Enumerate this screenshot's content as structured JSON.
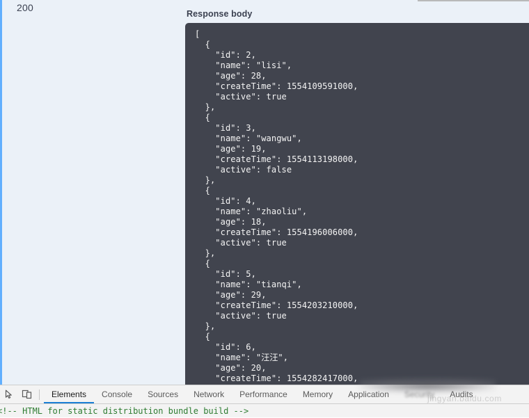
{
  "swagger": {
    "status_code": "200",
    "response_body_label": "Response body",
    "response_body_json": "[\n  {\n    \"id\": 2,\n    \"name\": \"lisi\",\n    \"age\": 28,\n    \"createTime\": 1554109591000,\n    \"active\": true\n  },\n  {\n    \"id\": 3,\n    \"name\": \"wangwu\",\n    \"age\": 19,\n    \"createTime\": 1554113198000,\n    \"active\": false\n  },\n  {\n    \"id\": 4,\n    \"name\": \"zhaoliu\",\n    \"age\": 18,\n    \"createTime\": 1554196006000,\n    \"active\": true\n  },\n  {\n    \"id\": 5,\n    \"name\": \"tianqi\",\n    \"age\": 29,\n    \"createTime\": 1554203210000,\n    \"active\": true\n  },\n  {\n    \"id\": 6,\n    \"name\": \"汪汪\",\n    \"age\": 20,\n    \"createTime\": 1554282417000,",
    "records": [
      {
        "id": 2,
        "name": "lisi",
        "age": 28,
        "createTime": 1554109591000,
        "active": true
      },
      {
        "id": 3,
        "name": "wangwu",
        "age": 19,
        "createTime": 1554113198000,
        "active": false
      },
      {
        "id": 4,
        "name": "zhaoliu",
        "age": 18,
        "createTime": 1554196006000,
        "active": true
      },
      {
        "id": 5,
        "name": "tianqi",
        "age": 29,
        "createTime": 1554203210000,
        "active": true
      },
      {
        "id": 6,
        "name": "汪汪",
        "age": 20,
        "createTime": 1554282417000
      }
    ],
    "accent_color": "#61affe",
    "panel_bg": "#ebf1f8",
    "code_bg": "#41444e"
  },
  "devtools": {
    "tabs": [
      {
        "label": "Elements",
        "active": true,
        "blurred": false
      },
      {
        "label": "Console",
        "active": false,
        "blurred": false
      },
      {
        "label": "Sources",
        "active": false,
        "blurred": false
      },
      {
        "label": "Network",
        "active": false,
        "blurred": false
      },
      {
        "label": "Performance",
        "active": false,
        "blurred": false
      },
      {
        "label": "Memory",
        "active": false,
        "blurred": false
      },
      {
        "label": "Application",
        "active": false,
        "blurred": false
      },
      {
        "label": "Security",
        "active": false,
        "blurred": true
      },
      {
        "label": "Audits",
        "active": false,
        "blurred": false
      }
    ],
    "inspect_icon": "inspect-cursor-icon",
    "device_toolbar_icon": "device-toolbar-icon",
    "code_line": "<!-- HTML for static distribution bundle build -->",
    "active_tab_underline_color": "#1a7fd4",
    "comment_color": "#2e7d32"
  },
  "watermark": {
    "text": "jingyan.baidu.com"
  }
}
